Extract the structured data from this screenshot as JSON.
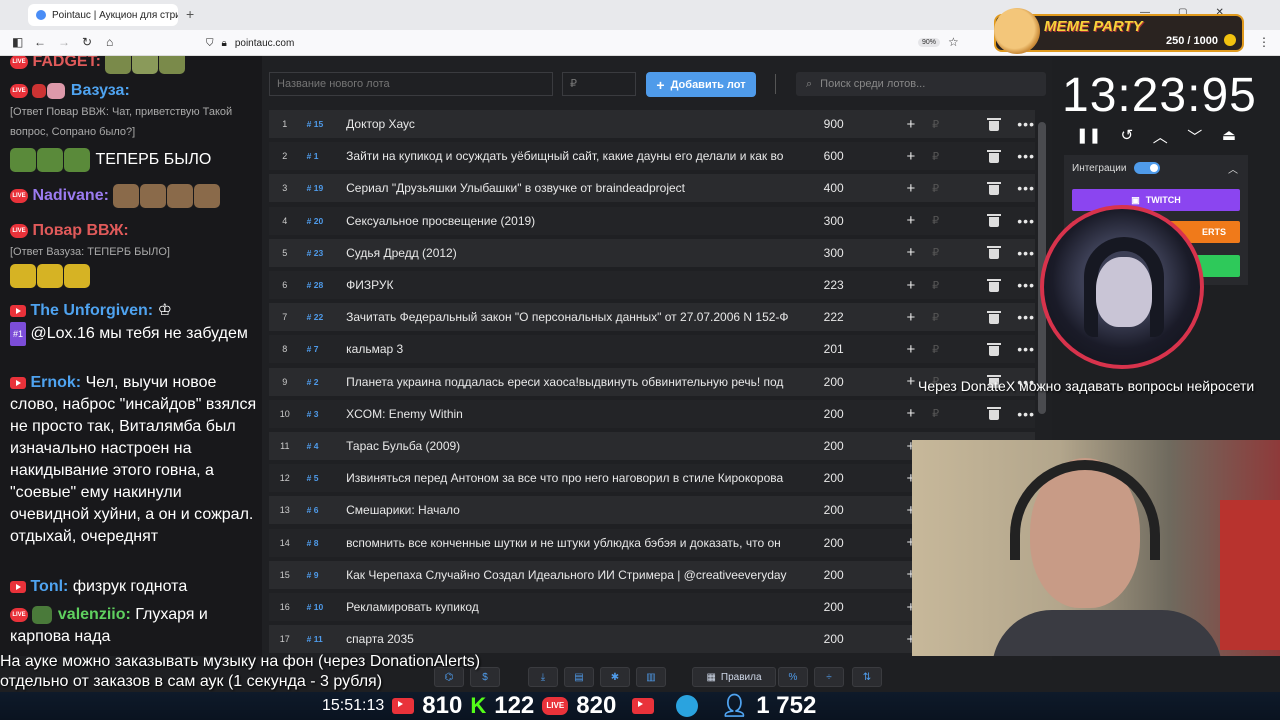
{
  "browser": {
    "tab_title": "Pointauc | Аукцион для стрим",
    "url": "pointauc.com",
    "zoom": "90%"
  },
  "meme_party": {
    "title": "MEME PARTY",
    "count": "250 / 1000"
  },
  "chat": {
    "messages": [
      {
        "user": "FADGET:",
        "text": ""
      },
      {
        "user": "Вазуза:",
        "text": ""
      },
      {
        "reply": "[Ответ Повар ВВЖ: Чат, приветствую Такой вопрос, Сопрано было?]"
      },
      {
        "text": "ТЕПЕРБ БЫЛО"
      },
      {
        "user": "Nadivane:",
        "text": ""
      },
      {
        "user": "Повар ВВЖ:",
        "text": ""
      },
      {
        "reply": "[Ответ Вазуза: ТЕПЕРБ БЫЛО]"
      },
      {
        "user": "The Unforgiven:",
        "text": ""
      },
      {
        "badge": "#1",
        "text": "@Lox.16 мы тебя не забудем"
      },
      {
        "user": "Ernok:",
        "text": "Чел, выучи новое слово, наброс \"инсайдов\" взялся не просто так, Виталямба был изначально настроен на накидывание этого говна, а \"соевые\" ему накинули очевидной хуйни, а он и сожрал. отдыхай, очереднят"
      },
      {
        "user": "Tonl:",
        "text": "физрук годнота"
      },
      {
        "user": "valenziio:",
        "text": "Глухаря и карпова нада"
      }
    ]
  },
  "auction": {
    "lot_name_placeholder": "Название нового лота",
    "price_placeholder": "₽",
    "add_button": "Добавить лот",
    "search_placeholder": "Поиск среди лотов...",
    "currency": "₽",
    "lots": [
      {
        "n": "1",
        "id": "# 15",
        "name": "Доктор Хаус",
        "amount": "900"
      },
      {
        "n": "2",
        "id": "# 1",
        "name": "Зайти на купикод и осуждать уёбищный сайт, какие дауны его делали и как во",
        "amount": "600"
      },
      {
        "n": "3",
        "id": "# 19",
        "name": "Сериал \"Друзьяшки Улыбашки\" в озвучке от braindeadproject",
        "amount": "400"
      },
      {
        "n": "4",
        "id": "# 20",
        "name": "Сексуальное просвещение (2019)",
        "amount": "300"
      },
      {
        "n": "5",
        "id": "# 23",
        "name": "Судья Дредд (2012)",
        "amount": "300"
      },
      {
        "n": "6",
        "id": "# 28",
        "name": "ФИЗРУК",
        "amount": "223"
      },
      {
        "n": "7",
        "id": "# 22",
        "name": "Зачитать Федеральный закон \"О персональных данных\" от 27.07.2006 N 152-Ф",
        "amount": "222"
      },
      {
        "n": "8",
        "id": "# 7",
        "name": "кальмар 3",
        "amount": "201"
      },
      {
        "n": "9",
        "id": "# 2",
        "name": "Планета украина поддалась ереси хаоса!выдвинуть обвинительную речь! под",
        "amount": "200"
      },
      {
        "n": "10",
        "id": "# 3",
        "name": "XCOM: Enemy Within",
        "amount": "200"
      },
      {
        "n": "11",
        "id": "# 4",
        "name": "Тарас Бульба (2009)",
        "amount": "200"
      },
      {
        "n": "12",
        "id": "# 5",
        "name": "Извиняться перед Антоном за все что про него наговорил в стиле Кирокорова",
        "amount": "200"
      },
      {
        "n": "13",
        "id": "# 6",
        "name": "Смешарики: Начало",
        "amount": "200"
      },
      {
        "n": "14",
        "id": "# 8",
        "name": "вспомнить все конченные шутки и не штуки ублюдка бэбэя и доказать, что он",
        "amount": "200"
      },
      {
        "n": "15",
        "id": "# 9",
        "name": "Как Черепаха Случайно Создал Идеального ИИ Стримера | @creativeeveryday",
        "amount": "200"
      },
      {
        "n": "16",
        "id": "# 10",
        "name": "Рекламировать купикод",
        "amount": "200"
      },
      {
        "n": "17",
        "id": "# 11",
        "name": "спарта 2035",
        "amount": "200"
      }
    ]
  },
  "timer": "13:23:95",
  "integrations": {
    "label": "Интеграции",
    "twitch": "TWITCH",
    "alerts": "ERTS"
  },
  "overlay": {
    "donate_text": "Через DonateX можно задавать вопросы нейросети",
    "bottom_line1": "На ауке можно заказывать музыку на фон (через DonationAlerts)",
    "bottom_line2": "отдельно от заказов в сам аук (1 секунда - 3 рубля)",
    "rules_button": "Правила"
  },
  "stats": {
    "clock": "15:51:13",
    "youtube": "810",
    "kick": "122",
    "live": "820",
    "viewers": "1 752"
  }
}
